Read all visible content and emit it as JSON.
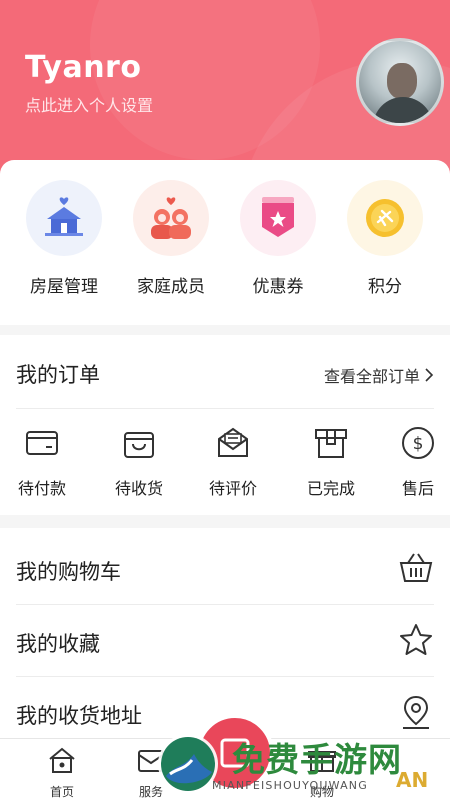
{
  "profile": {
    "username": "Tyanro",
    "subtitle": "点此进入个人设置"
  },
  "quick_links": [
    {
      "label": "房屋管理",
      "icon": "house-icon"
    },
    {
      "label": "家庭成员",
      "icon": "family-icon"
    },
    {
      "label": "优惠券",
      "icon": "coupon-icon"
    },
    {
      "label": "积分",
      "icon": "points-icon"
    }
  ],
  "orders": {
    "title": "我的订单",
    "view_all": "查看全部订单",
    "items": [
      {
        "label": "待付款",
        "icon": "wallet-icon"
      },
      {
        "label": "待收货",
        "icon": "bag-icon"
      },
      {
        "label": "待评价",
        "icon": "review-envelope-icon"
      },
      {
        "label": "已完成",
        "icon": "box-icon"
      },
      {
        "label": "售后",
        "icon": "dollar-icon"
      }
    ]
  },
  "menu": [
    {
      "label": "我的购物车",
      "icon": "basket-icon"
    },
    {
      "label": "我的收藏",
      "icon": "star-icon"
    },
    {
      "label": "我的收货地址",
      "icon": "location-pin-icon"
    }
  ],
  "tabbar": [
    {
      "label": "首页",
      "icon": "home-icon"
    },
    {
      "label": "服务",
      "icon": "service-icon"
    },
    {
      "label": "购物",
      "icon": "gift-icon"
    }
  ],
  "watermark": {
    "cn": "免费手游网",
    "en": "MIANFEISHOUYOUWANG",
    "corner": "AN"
  },
  "colors": {
    "brand": "#f46a78",
    "accent": "#e9475a"
  }
}
